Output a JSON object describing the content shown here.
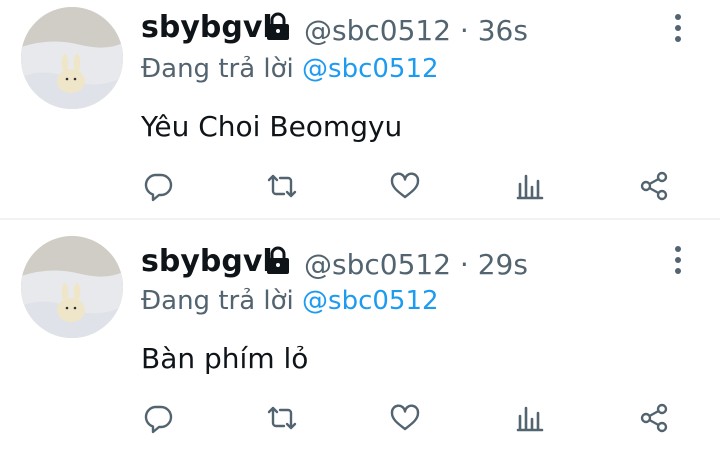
{
  "tweets": [
    {
      "display_name": "sbybgvl",
      "handle": "@sbc0512",
      "separator": "·",
      "time": "36s",
      "replying_prefix": "Đang trả lời",
      "replying_to": "@sbc0512",
      "text": "Yêu Choi Beomgyu",
      "avatar_icon": "avatar-plush-bunny-on-pillow",
      "locked": true
    },
    {
      "display_name": "sbybgvl",
      "handle": "@sbc0512",
      "separator": "·",
      "time": "29s",
      "replying_prefix": "Đang trả lời",
      "replying_to": "@sbc0512",
      "text": "Bàn phím lỏ",
      "avatar_icon": "avatar-plush-bunny-on-pillow",
      "locked": true
    }
  ],
  "action_icons": [
    "reply-icon",
    "retweet-icon",
    "like-icon",
    "views-icon",
    "share-icon"
  ],
  "colors": {
    "text": "#0f1419",
    "secondary": "#536471",
    "accent": "#1d9bf0",
    "divider": "#eff3f4"
  }
}
